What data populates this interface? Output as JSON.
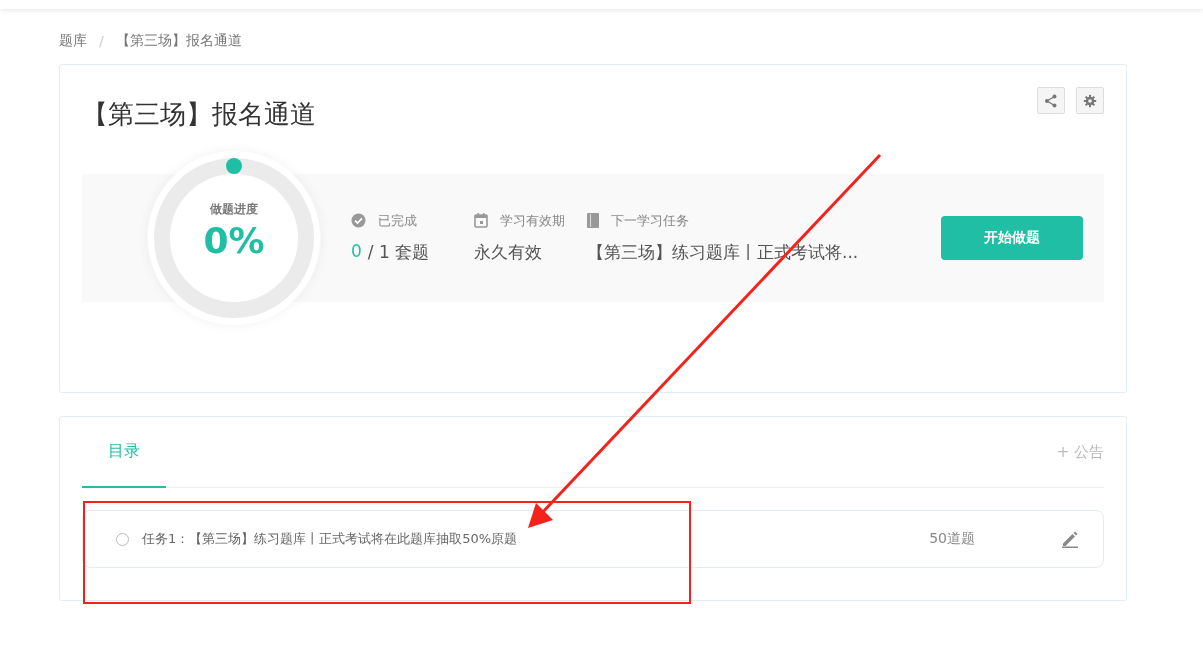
{
  "breadcrumb": [
    {
      "label": "题库"
    },
    {
      "label": "【第三场】报名通道"
    }
  ],
  "breadcrumb_separator": "/",
  "title": "【第三场】报名通道",
  "progress": {
    "label": "做题进度",
    "value": "0%"
  },
  "stats": [
    {
      "kind": "done",
      "label": "已完成",
      "count": "0",
      "value": "/ 1 套题"
    },
    {
      "kind": "validity",
      "label": "学习有效期",
      "value": "永久有效"
    },
    {
      "kind": "next",
      "label": "下一学习任务",
      "value": "【第三场】练习题库丨正式考试将..."
    }
  ],
  "start_button": "开始做题",
  "tabs": [
    {
      "label": "目录",
      "selected": true
    }
  ],
  "notice_button": "+ 公告",
  "tasks": [
    {
      "done": false,
      "label": "任务1：",
      "title": "【第三场】练习题库丨正式考试将在此题库抽取50%原题",
      "count": "50道题"
    }
  ]
}
